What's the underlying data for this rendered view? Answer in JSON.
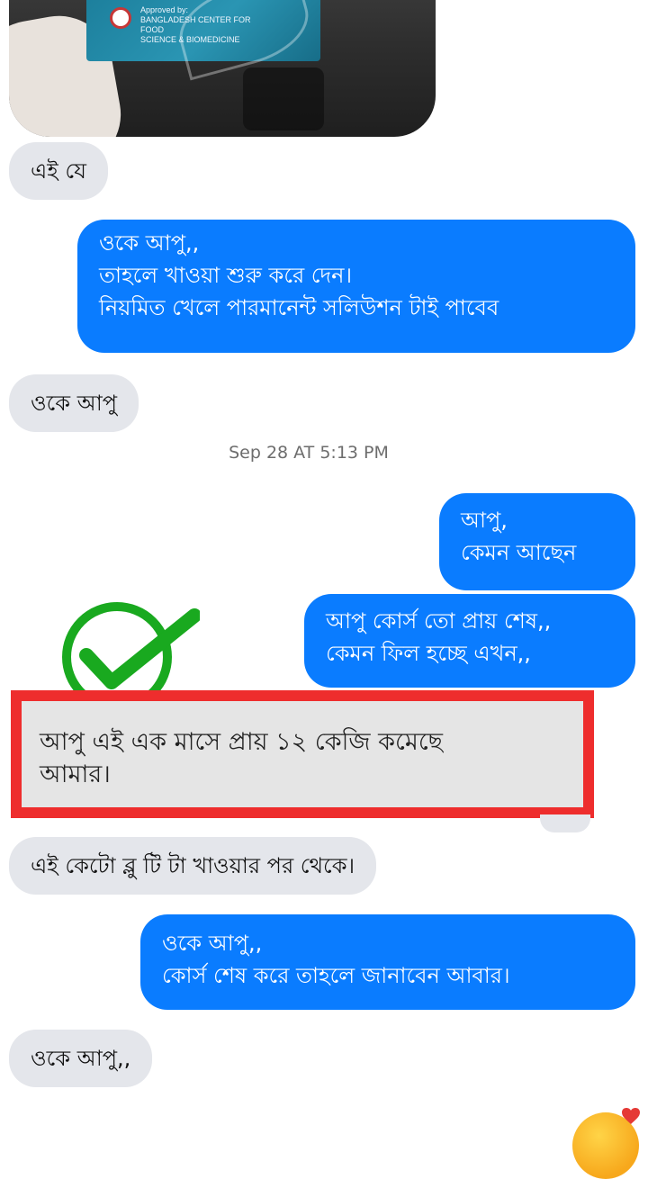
{
  "photo": {
    "box_text_line1": "Approved by:",
    "box_text_line2": "BANGLADESH CENTER FOR FOOD",
    "box_text_line3": "SCIENCE & BIOMEDICINE"
  },
  "messages": [
    {
      "dir": "in",
      "lines": [
        "এই যে"
      ]
    },
    {
      "dir": "out",
      "lines": [
        "ওকে আপু,,",
        "তাহলে খাওয়া শুরু করে দেন।",
        "নিয়মিত খেলে পারমানেন্ট সলিউশন টাই পাবেব"
      ]
    },
    {
      "dir": "in",
      "lines": [
        "ওকে আপু"
      ]
    },
    {
      "dir": "out",
      "lines": [
        "আপু,",
        "কেমন আছেন"
      ]
    },
    {
      "dir": "out",
      "lines": [
        "আপু কোর্স তো প্রায় শেষ,,",
        "কেমন ফিল হচ্ছে এখন,,"
      ]
    },
    {
      "dir": "in",
      "lines": [
        "এই কেটো ব্লু টি টা খাওয়ার পর থেকে।"
      ]
    },
    {
      "dir": "out",
      "lines": [
        "ওকে আপু,,",
        "কোর্স শেষ করে তাহলে জানাবেন আবার।"
      ]
    },
    {
      "dir": "in",
      "lines": [
        "ওকে আপু,,"
      ]
    }
  ],
  "timestamp": "Sep 28 AT 5:13 PM",
  "highlighted_message": {
    "lines": [
      "আপু এই এক মাসে প্রায় ১২ কেজি কমেছে",
      "আমার।"
    ]
  },
  "colors": {
    "outgoing_bubble": "#0a7cff",
    "incoming_bubble": "#e4e6eb",
    "highlight_border": "#ee2d2d",
    "checkmark": "#19a91f"
  },
  "icons": {
    "checkmark": "check-circle-icon",
    "reaction": "reaction-emoji-icon",
    "sticker": "smiling-face-with-hearts-icon"
  }
}
